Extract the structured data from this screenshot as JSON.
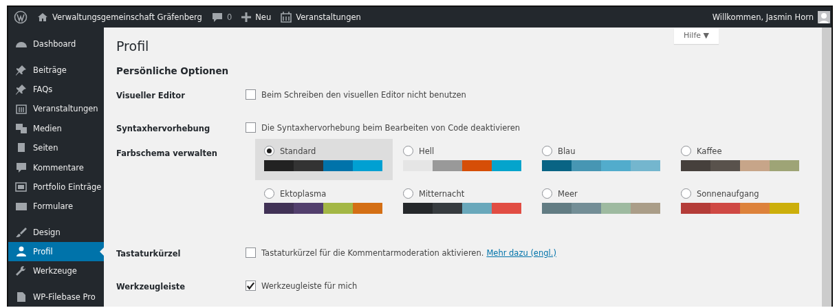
{
  "admin_bar": {
    "site_name": "Verwaltungsgemeinschaft Gräfenberg",
    "comments_count": "0",
    "new_label": "Neu",
    "events_label": "Veranstaltungen",
    "greeting": "Willkommen, Jasmin Horn"
  },
  "sidebar": {
    "items": [
      {
        "label": "Dashboard",
        "selected": false,
        "gap_before": false
      },
      {
        "label": "Beiträge",
        "selected": false,
        "gap_before": true
      },
      {
        "label": "FAQs",
        "selected": false,
        "gap_before": false
      },
      {
        "label": "Veranstaltungen",
        "selected": false,
        "gap_before": false
      },
      {
        "label": "Medien",
        "selected": false,
        "gap_before": false
      },
      {
        "label": "Seiten",
        "selected": false,
        "gap_before": false
      },
      {
        "label": "Kommentare",
        "selected": false,
        "gap_before": false
      },
      {
        "label": "Portfolio Einträge",
        "selected": false,
        "gap_before": false
      },
      {
        "label": "Formulare",
        "selected": false,
        "gap_before": false
      },
      {
        "label": "Design",
        "selected": false,
        "gap_before": true
      },
      {
        "label": "Profil",
        "selected": true,
        "gap_before": false
      },
      {
        "label": "Werkzeuge",
        "selected": false,
        "gap_before": false
      },
      {
        "label": "WP-Filebase Pro",
        "selected": false,
        "gap_before": true
      }
    ]
  },
  "help_button": "Hilfe ▼",
  "page_title": "Profil",
  "section_title": "Persönliche Optionen",
  "rows": [
    {
      "kind": "checkbox",
      "label": "Visueller Editor",
      "text": "Beim Schreiben den visuellen Editor nicht benutzen",
      "checked": false
    },
    {
      "kind": "checkbox",
      "label": "Syntaxhervorhebung",
      "text": "Die Syntaxhervorhebung beim Bearbeiten von Code deaktivieren",
      "checked": false
    },
    {
      "kind": "schemes",
      "label": "Farbschema verwalten",
      "schemes": [
        {
          "name": "Standard",
          "selected": true,
          "swatches": [
            {
              "color": "#222222"
            },
            {
              "color": "#333333"
            },
            {
              "color": "#0073aa"
            },
            {
              "color": "#00a0d2"
            }
          ]
        },
        {
          "name": "Hell",
          "selected": false,
          "swatches": [
            {
              "color": "#e5e5e5"
            },
            {
              "color": "#999999"
            },
            {
              "color": "#d64e07"
            },
            {
              "color": "#04a4cc"
            }
          ]
        },
        {
          "name": "Blau",
          "selected": false,
          "swatches": [
            {
              "color": "#096484"
            },
            {
              "color": "#4796b3"
            },
            {
              "color": "#52accc"
            },
            {
              "color": "#74b6ce"
            }
          ]
        },
        {
          "name": "Kaffee",
          "selected": false,
          "swatches": [
            {
              "color": "#46403c"
            },
            {
              "color": "#59524c"
            },
            {
              "color": "#c7a589"
            },
            {
              "color": "#9ea476"
            }
          ]
        },
        {
          "name": "Ektoplasma",
          "selected": false,
          "swatches": [
            {
              "color": "#413256"
            },
            {
              "color": "#523f6d"
            },
            {
              "color": "#a3b745"
            },
            {
              "color": "#d46f15"
            }
          ]
        },
        {
          "name": "Mitternacht",
          "selected": false,
          "swatches": [
            {
              "color": "#25282b"
            },
            {
              "color": "#363b3f"
            },
            {
              "color": "#69a8bb"
            },
            {
              "color": "#e14d43"
            }
          ]
        },
        {
          "name": "Meer",
          "selected": false,
          "swatches": [
            {
              "color": "#627c83"
            },
            {
              "color": "#738e96"
            },
            {
              "color": "#9ebaa0"
            },
            {
              "color": "#aa9d88"
            }
          ]
        },
        {
          "name": "Sonnenaufgang",
          "selected": false,
          "swatches": [
            {
              "color": "#b43c38"
            },
            {
              "color": "#cf4944"
            },
            {
              "color": "#dd823b"
            },
            {
              "color": "#ccaf0b"
            }
          ]
        }
      ]
    },
    {
      "kind": "checkbox",
      "label": "Tastaturkürzel",
      "text": "Tastaturkürzel für die Kommentarmoderation aktivieren.",
      "link": "Mehr dazu (engl.)",
      "checked": false
    },
    {
      "kind": "checkbox",
      "label": "Werkzeugleiste",
      "text": "Werkzeugleiste für mich",
      "checked": true
    }
  ]
}
